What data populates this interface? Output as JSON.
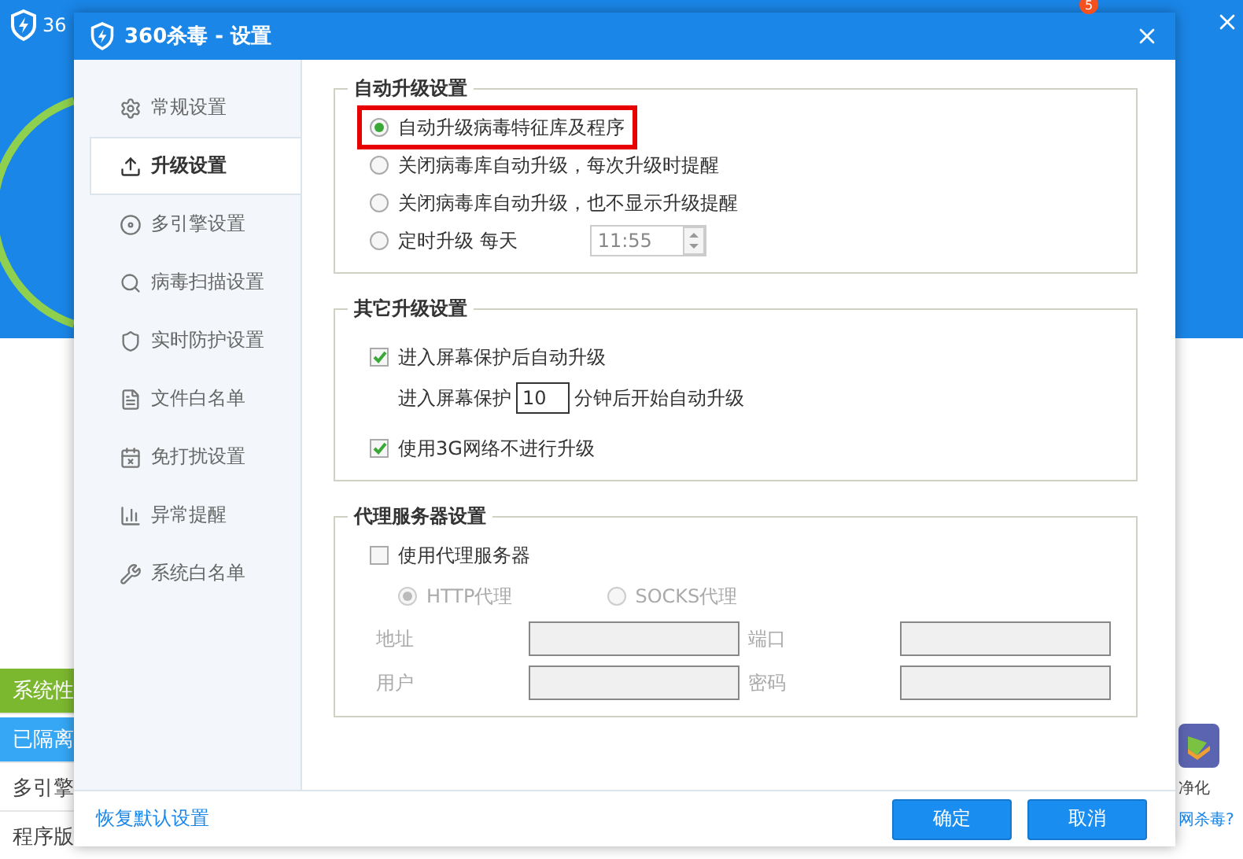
{
  "background_app": {
    "title": "36",
    "badge": "5",
    "side_labels": [
      {
        "label": "系统性",
        "color": "#7cb82f"
      },
      {
        "label": "已隔离",
        "color": "#35a7f5"
      },
      {
        "label": "多引擎",
        "color": "#ffffff"
      },
      {
        "label": "程序版",
        "color": "#ffffff"
      }
    ],
    "right_labels": [
      "净化",
      "网杀毒?"
    ]
  },
  "dialog": {
    "title": "360杀毒 - 设置"
  },
  "sidebar": {
    "items": [
      {
        "label": "常规设置",
        "selected": false
      },
      {
        "label": "升级设置",
        "selected": true
      },
      {
        "label": "多引擎设置",
        "selected": false
      },
      {
        "label": "病毒扫描设置",
        "selected": false
      },
      {
        "label": "实时防护设置",
        "selected": false
      },
      {
        "label": "文件白名单",
        "selected": false
      },
      {
        "label": "免打扰设置",
        "selected": false
      },
      {
        "label": "异常提醒",
        "selected": false
      },
      {
        "label": "系统白名单",
        "selected": false
      }
    ]
  },
  "auto_upgrade": {
    "title": "自动升级设置",
    "options": [
      {
        "kind": "plain",
        "label": "自动升级病毒特征库及程序",
        "selected": true,
        "highlighted": true
      },
      {
        "kind": "plain",
        "label": "关闭病毒库自动升级，每次升级时提醒",
        "selected": false,
        "highlighted": false
      },
      {
        "kind": "plain",
        "label": "关闭病毒库自动升级，也不显示升级提醒",
        "selected": false,
        "highlighted": false
      },
      {
        "kind": "schedule",
        "label": "定时升级 每天",
        "time": "11:55",
        "selected": false,
        "highlighted": false
      }
    ]
  },
  "other_upgrade": {
    "title": "其它升级设置",
    "items": [
      {
        "kind": "checkbox",
        "label": "进入屏幕保护后自动升级",
        "checked": true
      },
      {
        "kind": "delay",
        "prefix": "进入屏幕保护",
        "value": "10",
        "suffix": "分钟后开始自动升级"
      },
      {
        "kind": "checkbox",
        "label": "使用3G网络不进行升级",
        "checked": true
      }
    ]
  },
  "proxy": {
    "title": "代理服务器设置",
    "use_proxy": {
      "label": "使用代理服务器",
      "checked": false
    },
    "disabled": true,
    "types": [
      {
        "label": "HTTP代理",
        "selected": true
      },
      {
        "label": "SOCKS代理",
        "selected": false
      }
    ],
    "fields": [
      {
        "label": "地址"
      },
      {
        "label": "端口"
      },
      {
        "label": "用户"
      },
      {
        "label": "密码"
      }
    ]
  },
  "footer": {
    "restore_link": "恢复默认设置",
    "buttons": [
      "确定",
      "取消"
    ]
  }
}
